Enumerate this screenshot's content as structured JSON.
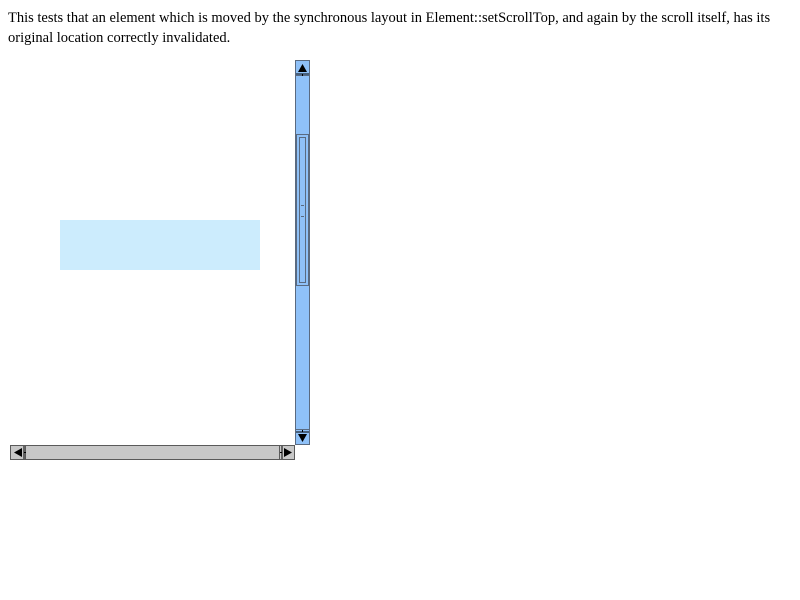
{
  "description": {
    "text": "This tests that an element which is moved by the synchronous layout in Element::setScrollTop, and again by the scroll itself, has its original location correctly invalidated."
  },
  "scroller": {
    "moved_box_color": "#ccecfd",
    "vertical_scrollbar": {
      "track_color": "#8fc1f8",
      "up_icon": "arrow-up-icon",
      "down_icon": "arrow-down-icon"
    },
    "horizontal_scrollbar": {
      "track_color": "#c8c8c8",
      "left_icon": "arrow-left-icon",
      "right_icon": "arrow-right-icon"
    }
  }
}
